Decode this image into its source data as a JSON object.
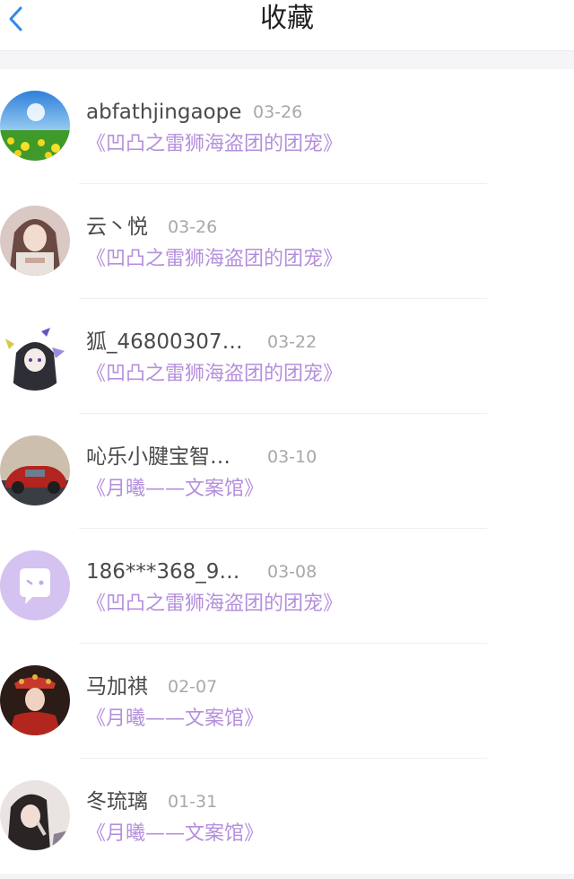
{
  "header": {
    "title": "收藏",
    "back_icon": "chevron-left-icon",
    "accent_color": "#2f8ae8"
  },
  "colors": {
    "link_purple": "#b48fdc",
    "name_text": "#4a4a4a",
    "date_text": "#a8a8a8"
  },
  "favorites": [
    {
      "name": "abfathjingaope",
      "date": "03-26",
      "title": "《凹凸之雷狮海盗团的团宠》"
    },
    {
      "name": "云丶悦",
      "date": "03-26",
      "title": "《凹凸之雷狮海盗团的团宠》"
    },
    {
      "name": "狐_46800307…",
      "date": "03-22",
      "title": "《凹凸之雷狮海盗团的团宠》"
    },
    {
      "name": "吣乐小腱宝智…",
      "date": "03-10",
      "title": "《月曦——文案馆》"
    },
    {
      "name": "186***368_9…",
      "date": "03-08",
      "title": "《凹凸之雷狮海盗团的团宠》"
    },
    {
      "name": "马加祺",
      "date": "02-07",
      "title": "《月曦——文案馆》"
    },
    {
      "name": "冬琉璃",
      "date": "01-31",
      "title": "《月曦——文案馆》"
    }
  ]
}
